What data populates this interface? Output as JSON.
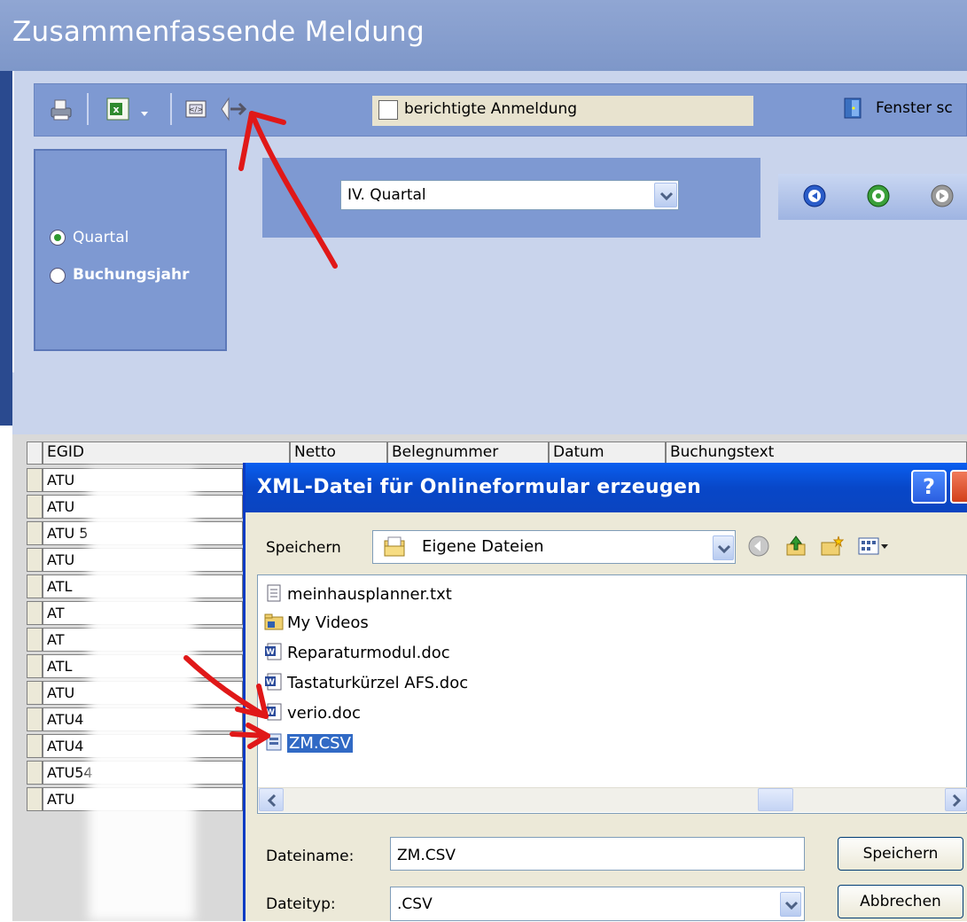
{
  "window": {
    "title": "Zusammenfassende Meldung"
  },
  "toolbar": {
    "icons": [
      "printer-icon",
      "excel-export-icon",
      "dropdown-arrow-icon",
      "xml-export-icon",
      "exit-icon"
    ],
    "checkbox_label": "berichtigte Anmeldung",
    "close_window_label": "Fenster sc"
  },
  "period": {
    "options": [
      {
        "label": "Quartal",
        "selected": true
      },
      {
        "label": "Buchungsjahr",
        "selected": false
      }
    ],
    "combo_value": "IV. Quartal"
  },
  "grid": {
    "columns": [
      "EGID",
      "Netto",
      "Belegnummer",
      "Datum",
      "Buchungstext"
    ],
    "rows": [
      "ATU",
      "ATU",
      "ATU 5",
      "ATU",
      "ATL",
      "AT",
      "AT",
      "ATL",
      "ATU",
      "ATU4",
      "ATU4",
      "ATU54",
      "ATU"
    ]
  },
  "dialog": {
    "title": "XML-Datei für Onlineformular erzeugen",
    "help_label": "?",
    "save_in_label": "Speichern",
    "save_in_value": "Eigene Dateien",
    "files": [
      {
        "name": "meinhausplanner.txt",
        "icon": "text-file-icon"
      },
      {
        "name": "My Videos",
        "icon": "video-folder-icon"
      },
      {
        "name": "Reparaturmodul.doc",
        "icon": "word-document-icon"
      },
      {
        "name": "Tastaturkürzel AFS.doc",
        "icon": "word-document-icon"
      },
      {
        "name": "verio.doc",
        "icon": "word-document-icon"
      },
      {
        "name": "ZM.CSV",
        "icon": "csv-file-icon",
        "selected": true
      }
    ],
    "filename_label": "Dateiname:",
    "filename_value": "ZM.CSV",
    "filetype_label": "Dateityp:",
    "filetype_value": ".CSV",
    "save_button": "Speichern",
    "cancel_button": "Abbrechen"
  },
  "colors": {
    "title_blue": "#7e97c9",
    "panel_blue": "#7e99d2",
    "xp_title": "#0847c8",
    "selection": "#316ac5",
    "arrow_red": "#e01818"
  }
}
